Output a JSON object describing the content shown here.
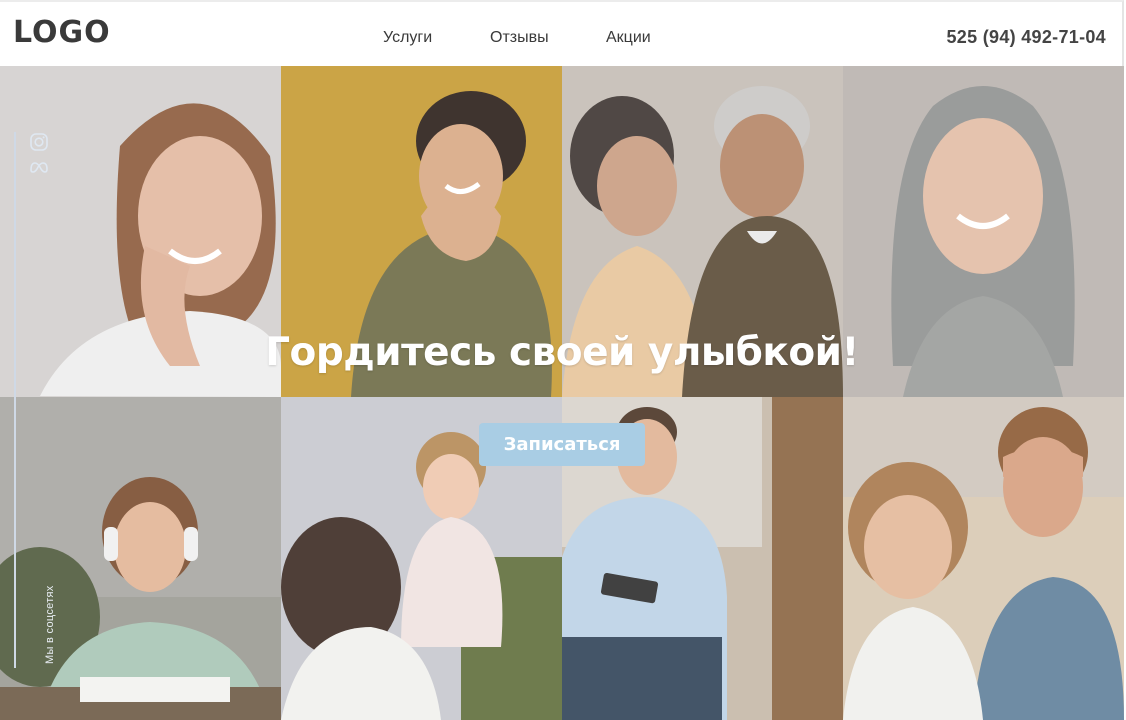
{
  "header": {
    "logo": "LOGO",
    "nav": [
      {
        "label": "Услуги"
      },
      {
        "label": "Отзывы"
      },
      {
        "label": "Акции"
      }
    ],
    "phone": "525 (94) 492-71-04"
  },
  "social": {
    "icons": [
      "instagram-icon",
      "meta-icon"
    ],
    "label": "Мы в соцсетях"
  },
  "hero": {
    "headline": "Гордитесь своей улыбкой!",
    "cta_label": "Записаться",
    "photos": [
      {
        "name": "photo-woman-hand-on-cheek",
        "bg": "#c9c5c2"
      },
      {
        "name": "photo-woman-laughing-mustard",
        "bg": "#c6962c"
      },
      {
        "name": "photo-elderly-couple-laughing",
        "bg": "#b9b0a6"
      },
      {
        "name": "photo-woman-gray-hair",
        "bg": "#b8b1ab"
      },
      {
        "name": "photo-girl-headphones",
        "bg": "#8a8a7f"
      },
      {
        "name": "photo-mother-lifting-daughter",
        "bg": "#b7b29c"
      },
      {
        "name": "photo-man-with-tablet",
        "bg": "#b2a69a"
      },
      {
        "name": "photo-couple-eyes-covered",
        "bg": "#c2ac94"
      }
    ]
  },
  "colors": {
    "cta": "#a9cde4",
    "text_dark": "#3a3a3a",
    "rail_line": "#cfd9e6"
  }
}
